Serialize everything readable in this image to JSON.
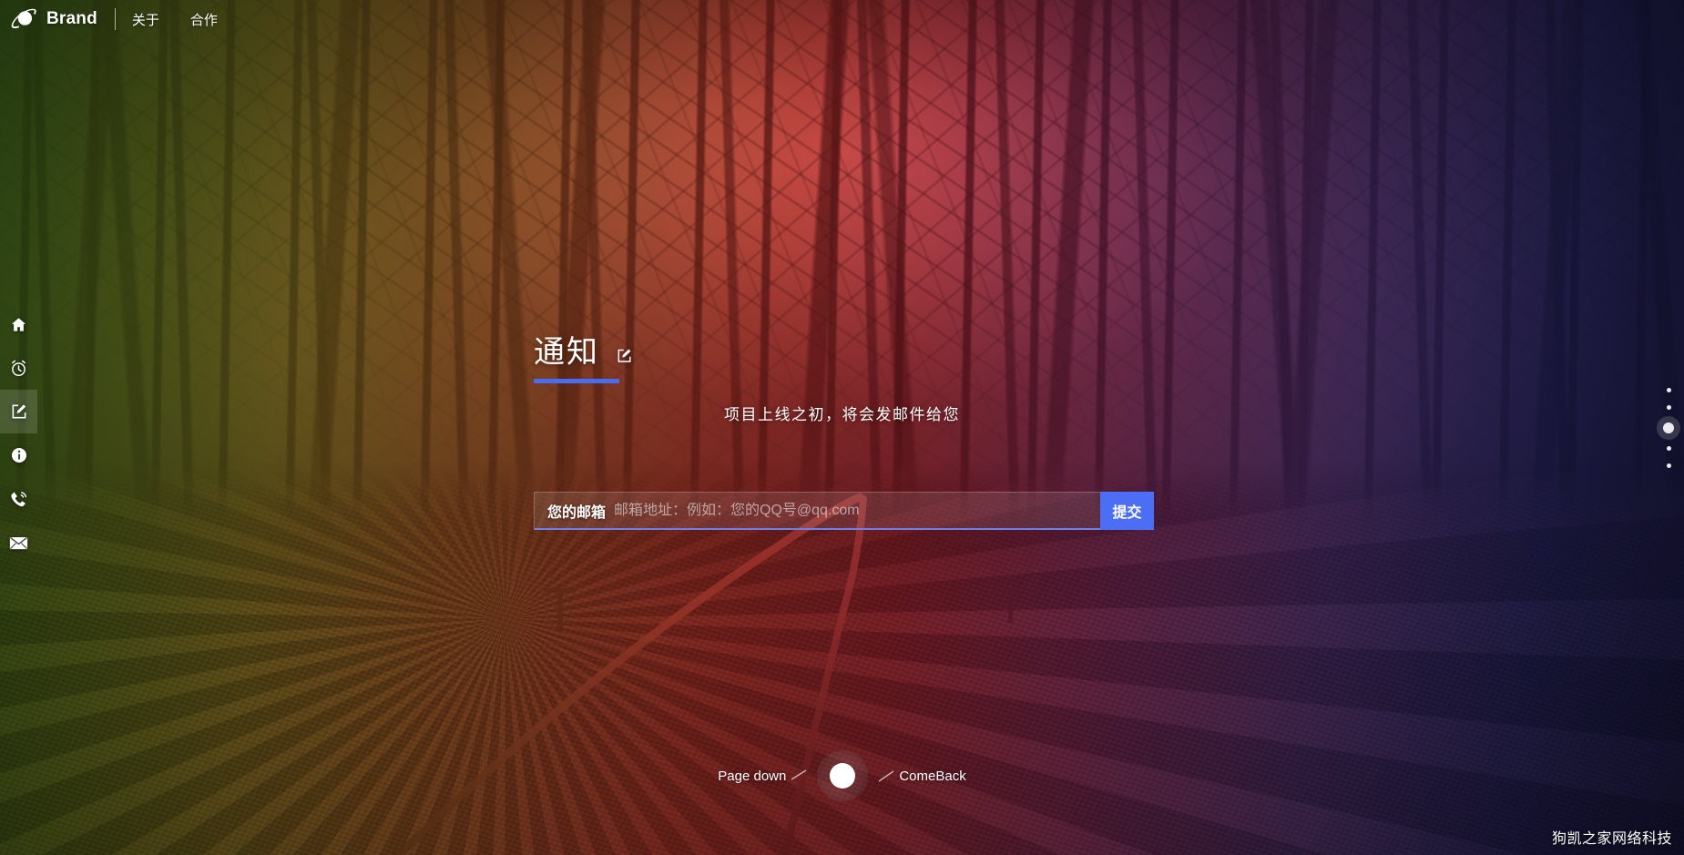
{
  "header": {
    "brand_icon": "saturn-planet-icon",
    "brand_name": "Brand",
    "nav": [
      {
        "label": "关于",
        "name": "nav-about"
      },
      {
        "label": "合作",
        "name": "nav-cooperation"
      }
    ]
  },
  "sidebar": {
    "items": [
      {
        "icon": "home-icon",
        "name": "sidebar-item-home",
        "active": false
      },
      {
        "icon": "alarm-clock-icon",
        "name": "sidebar-item-alarm",
        "active": false
      },
      {
        "icon": "edit-square-icon",
        "name": "sidebar-item-notice",
        "active": true
      },
      {
        "icon": "info-circle-icon",
        "name": "sidebar-item-info",
        "active": false
      },
      {
        "icon": "phone-ring-icon",
        "name": "sidebar-item-contact",
        "active": false
      },
      {
        "icon": "envelope-icon",
        "name": "sidebar-item-mail",
        "active": false
      }
    ]
  },
  "hero": {
    "title": "通知",
    "title_icon": "edit-square-icon",
    "subtitle": "项目上线之初，将会发邮件给您"
  },
  "subscribe": {
    "label": "您的邮箱",
    "placeholder": "邮箱地址：例如：您的QQ号@qq.com",
    "value": "",
    "submit_label": "提交"
  },
  "page_dots": {
    "total": 5,
    "active_index": 2
  },
  "bottom": {
    "left_label": "Page down",
    "right_label": "ComeBack",
    "knob_icon": "scroll-knob-icon"
  },
  "watermark": {
    "text": "狗凯之家网络科技"
  },
  "colors": {
    "accent_blue": "#4c6ef5",
    "underline_blue": "#4a6cf0",
    "text_white": "#ffffff",
    "input_border": "#6d7fe8"
  }
}
